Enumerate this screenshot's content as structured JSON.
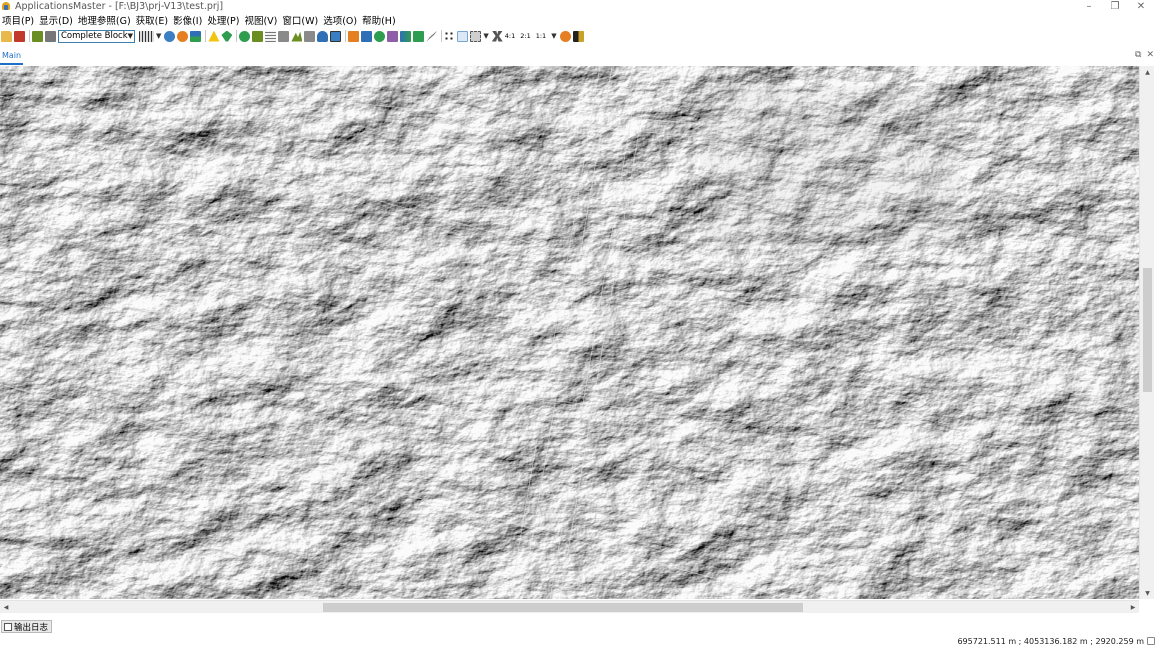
{
  "window": {
    "title": "ApplicationsMaster - [F:\\BJ3\\prj-V13\\test.prj]",
    "controls": {
      "minimize": "–",
      "restore": "❐",
      "close": "✕"
    }
  },
  "menu": [
    "项目(P)",
    "显示(D)",
    "地理参照(G)",
    "获取(E)",
    "影像(I)",
    "处理(P)",
    "视图(V)",
    "窗口(W)",
    "选项(O)",
    "帮助(H)"
  ],
  "toolbar": {
    "block_select": {
      "value": "Complete Block"
    },
    "zoom_ratios": [
      "4:1",
      "2:1",
      "1:1"
    ],
    "icon_colors": {
      "open": "#e8b84a",
      "save": "#c0392b",
      "edit": "#6b8e23",
      "print": "#777777",
      "globe": "#3a7fc4",
      "orange": "#e67e22",
      "green": "#2e9d4f",
      "yellow": "#f1c40f",
      "blue": "#2f6fb5",
      "gray": "#8a8a8a",
      "purple": "#8e5ea8"
    }
  },
  "document_tabs": [
    {
      "label": "Main",
      "active": true
    }
  ],
  "tab_controls": {
    "float": "⧉",
    "close": "✕"
  },
  "map": {
    "type": "panchromatic satellite image mosaic",
    "coloring": "grayscale"
  },
  "bottom_panel": {
    "tab_label": "输出日志"
  },
  "status": {
    "coordinates": "695721.511 m ; 4053136.182 m ; 2920.259 m"
  }
}
